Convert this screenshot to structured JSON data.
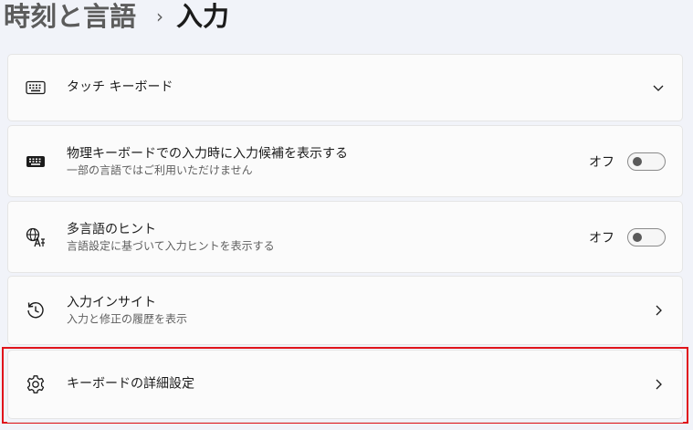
{
  "breadcrumb": {
    "parent": "時刻と言語",
    "separator": "›",
    "current": "入力"
  },
  "items": [
    {
      "title": "タッチ キーボード",
      "icon": "touch-keyboard-icon",
      "control": "chevron-down"
    },
    {
      "title": "物理キーボードでの入力時に入力候補を表示する",
      "subtitle": "一部の言語ではご利用いただけません",
      "icon": "keyboard-icon",
      "control": "toggle",
      "toggle_label": "オフ",
      "toggle_on": false
    },
    {
      "title": "多言語のヒント",
      "subtitle": "言語設定に基づいて入力ヒントを表示する",
      "icon": "language-icon",
      "control": "toggle",
      "toggle_label": "オフ",
      "toggle_on": false
    },
    {
      "title": "入力インサイト",
      "subtitle": "入力と修正の履歴を表示",
      "icon": "history-icon",
      "control": "chevron-right"
    },
    {
      "title": "キーボードの詳細設定",
      "icon": "gear-icon",
      "control": "chevron-right",
      "highlighted": true
    }
  ],
  "colors": {
    "background": "#f1f3f9",
    "card": "#fbfbfb",
    "highlight": "#e0141b"
  }
}
